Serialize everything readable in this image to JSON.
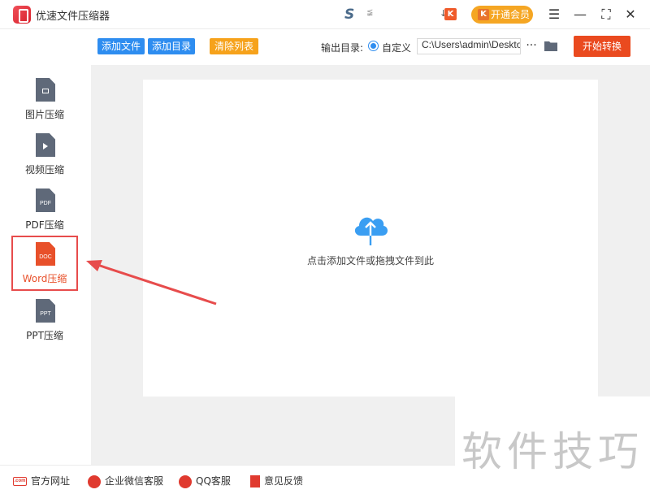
{
  "app": {
    "title": "优速文件压缩器",
    "vip_label": "开通会员",
    "k_glyph": "K",
    "s_glyph": "S",
    "small_glyph": "≨",
    "down_glyph": "↓"
  },
  "window_controls": {
    "menu": "☰",
    "minimize": "—",
    "maximize": "⛶",
    "close": "✕"
  },
  "toolbar": {
    "add_file": "添加文件",
    "add_dir": "添加目录",
    "clear_list": "清除列表",
    "output_label": "输出目录:",
    "custom_label": "自定义",
    "output_path": "C:\\Users\\admin\\Deskto",
    "more": "···",
    "start": "开始转换"
  },
  "sidebar": {
    "items": [
      {
        "label": "图片压缩",
        "tag": "",
        "icon": "image-doc-icon"
      },
      {
        "label": "视频压缩",
        "tag": "",
        "icon": "video-doc-icon"
      },
      {
        "label": "PDF压缩",
        "tag": "PDF",
        "icon": "pdf-doc-icon"
      },
      {
        "label": "Word压缩",
        "tag": "DOC",
        "icon": "word-doc-icon",
        "active": true
      },
      {
        "label": "PPT压缩",
        "tag": "PPT",
        "icon": "ppt-doc-icon"
      }
    ]
  },
  "main": {
    "drop_hint": "点击添加文件或拖拽文件到此"
  },
  "footer": {
    "website": "官方网址",
    "website_icon_text": ".com",
    "wechat": "企业微信客服",
    "qq": "QQ客服",
    "feedback": "意见反馈"
  },
  "watermark": "软件技巧",
  "colors": {
    "accent_blue": "#2e8df0",
    "orange": "#f6a21b",
    "start_red": "#ea4a1f",
    "active_red": "#e8502a"
  }
}
